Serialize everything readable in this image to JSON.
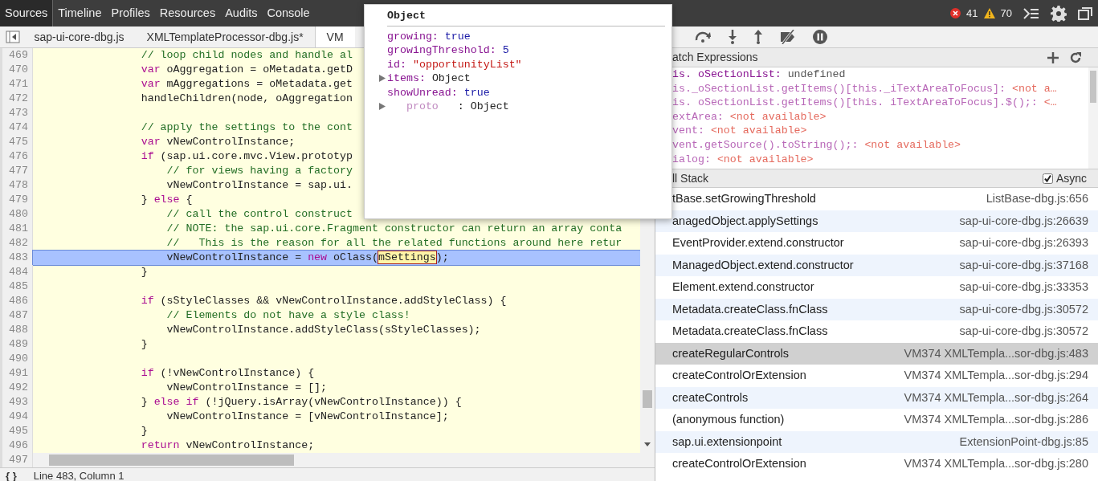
{
  "main_tabs": [
    {
      "label": "Sources",
      "selected": true
    },
    {
      "label": "Timeline",
      "selected": false
    },
    {
      "label": "Profiles",
      "selected": false
    },
    {
      "label": "Resources",
      "selected": false
    },
    {
      "label": "Audits",
      "selected": false
    },
    {
      "label": "Console",
      "selected": false
    }
  ],
  "error_count": "41",
  "warning_count": "70",
  "file_tabs": [
    {
      "label": "sap-ui-core-dbg.js",
      "selected": false
    },
    {
      "label": "XMLTemplateProcessor-dbg.js*",
      "selected": false
    },
    {
      "label": "VM",
      "selected": true
    }
  ],
  "code_lines": [
    {
      "number": "469",
      "selected": false,
      "tokens": [
        {
          "kind": "comment",
          "text": "                // loop child nodes and handle al"
        }
      ]
    },
    {
      "number": "470",
      "selected": false,
      "tokens": [
        {
          "kind": "keyword",
          "text": "                var"
        },
        {
          "kind": "plain",
          "text": " oAggregation = oMetadata.getD"
        }
      ]
    },
    {
      "number": "471",
      "selected": false,
      "tokens": [
        {
          "kind": "keyword",
          "text": "                var"
        },
        {
          "kind": "plain",
          "text": " mAggregations = oMetadata.get"
        }
      ]
    },
    {
      "number": "472",
      "selected": false,
      "tokens": [
        {
          "kind": "plain",
          "text": "                handleChildren(node, oAggregation"
        }
      ]
    },
    {
      "number": "473",
      "selected": false
    },
    {
      "number": "474",
      "selected": false,
      "tokens": [
        {
          "kind": "comment",
          "text": "                // apply the settings to the cont"
        }
      ]
    },
    {
      "number": "475",
      "selected": false,
      "tokens": [
        {
          "kind": "keyword",
          "text": "                var"
        },
        {
          "kind": "plain",
          "text": " vNewControlInstance;"
        }
      ]
    },
    {
      "number": "476",
      "selected": false,
      "tokens": [
        {
          "kind": "keyword",
          "text": "                if"
        },
        {
          "kind": "plain",
          "text": " (sap.ui.core.mvc.View.prototyp"
        }
      ]
    },
    {
      "number": "477",
      "selected": false,
      "tokens": [
        {
          "kind": "comment",
          "text": "                    // for views having a factory"
        }
      ]
    },
    {
      "number": "478",
      "selected": false,
      "tokens": [
        {
          "kind": "plain",
          "text": "                    vNewControlInstance = sap.ui."
        }
      ]
    },
    {
      "number": "479",
      "selected": false,
      "tokens": [
        {
          "kind": "plain",
          "text": "                } "
        },
        {
          "kind": "keyword",
          "text": "else"
        },
        {
          "kind": "plain",
          "text": " {"
        }
      ]
    },
    {
      "number": "480",
      "selected": false,
      "tokens": [
        {
          "kind": "comment",
          "text": "                    // call the control construct"
        }
      ]
    },
    {
      "number": "481",
      "selected": false,
      "tokens": [
        {
          "kind": "comment",
          "text": "                    // NOTE: the sap.ui.core.Fragment constructor can return an array conta"
        }
      ]
    },
    {
      "number": "482",
      "selected": false,
      "tokens": [
        {
          "kind": "comment",
          "text": "                    //   This is the reason for all the related functions around here retur"
        }
      ]
    },
    {
      "number": "483",
      "selected": true,
      "tokens": [
        {
          "kind": "plain",
          "text": "                    vNewControlInstance = "
        },
        {
          "kind": "keyword",
          "text": "new"
        },
        {
          "kind": "plain",
          "text": " oClass("
        },
        {
          "kind": "hovered",
          "text": "mSettings"
        },
        {
          "kind": "plain",
          "text": ");"
        }
      ]
    },
    {
      "number": "484",
      "selected": false,
      "tokens": [
        {
          "kind": "plain",
          "text": "                }"
        }
      ]
    },
    {
      "number": "485",
      "selected": false
    },
    {
      "number": "486",
      "selected": false,
      "tokens": [
        {
          "kind": "keyword",
          "text": "                if"
        },
        {
          "kind": "plain",
          "text": " (sStyleClasses && vNewControlInstance.addStyleClass) {"
        }
      ]
    },
    {
      "number": "487",
      "selected": false,
      "tokens": [
        {
          "kind": "comment",
          "text": "                    // Elements do not have a style class!"
        }
      ]
    },
    {
      "number": "488",
      "selected": false,
      "tokens": [
        {
          "kind": "plain",
          "text": "                    vNewControlInstance.addStyleClass(sStyleClasses);"
        }
      ]
    },
    {
      "number": "489",
      "selected": false,
      "tokens": [
        {
          "kind": "plain",
          "text": "                }"
        }
      ]
    },
    {
      "number": "490",
      "selected": false
    },
    {
      "number": "491",
      "selected": false,
      "tokens": [
        {
          "kind": "keyword",
          "text": "                if"
        },
        {
          "kind": "plain",
          "text": " (!vNewControlInstance) {"
        }
      ]
    },
    {
      "number": "492",
      "selected": false,
      "tokens": [
        {
          "kind": "plain",
          "text": "                    vNewControlInstance = [];"
        }
      ]
    },
    {
      "number": "493",
      "selected": false,
      "tokens": [
        {
          "kind": "plain",
          "text": "                } "
        },
        {
          "kind": "keyword",
          "text": "else if"
        },
        {
          "kind": "plain",
          "text": " (!jQuery.isArray(vNewControlInstance)) {"
        }
      ]
    },
    {
      "number": "494",
      "selected": false,
      "tokens": [
        {
          "kind": "plain",
          "text": "                    vNewControlInstance = [vNewControlInstance];"
        }
      ]
    },
    {
      "number": "495",
      "selected": false,
      "tokens": [
        {
          "kind": "plain",
          "text": "                }"
        }
      ]
    },
    {
      "number": "496",
      "selected": false,
      "tokens": [
        {
          "kind": "keyword",
          "text": "                return"
        },
        {
          "kind": "plain",
          "text": " vNewControlInstance;"
        }
      ]
    }
  ],
  "last_line_number": "497",
  "status_bar": {
    "icon_text": "{ }",
    "position": "Line 483, Column 1"
  },
  "popover": {
    "title": "Object",
    "properties": [
      {
        "name": "growing:",
        "value": "true",
        "kind": "literal",
        "expandable": false,
        "dimmed": false
      },
      {
        "name": "growingThreshold:",
        "value": "5",
        "kind": "literal",
        "expandable": false,
        "dimmed": false
      },
      {
        "name": "id:",
        "value": "\"opportunityList\"",
        "kind": "string",
        "expandable": false,
        "dimmed": false
      },
      {
        "name": "items:",
        "value": "Object",
        "kind": "object",
        "expandable": true,
        "dimmed": false
      },
      {
        "name": "showUnread:",
        "value": "true",
        "kind": "literal",
        "expandable": false,
        "dimmed": false
      },
      {
        "name": "proto",
        "value": ": Object",
        "kind": "object",
        "expandable": true,
        "dimmed": true
      }
    ]
  },
  "watch": {
    "title": "atch Expressions",
    "items": [
      {
        "name": "is. oSectionList:",
        "value": "undefined",
        "kind": "value"
      },
      {
        "name": "is._oSectionList.getItems()[this._iTextAreaToFocus]:",
        "value": "<not a…",
        "kind": "unavailable"
      },
      {
        "name": "is. oSectionList.getItems()[this. iTextAreaToFocus].$();:",
        "value": "<…",
        "kind": "unavailable"
      },
      {
        "name": "extArea:",
        "value": "<not available>",
        "kind": "unavailable"
      },
      {
        "name": "vent:",
        "value": "<not available>",
        "kind": "unavailable"
      },
      {
        "name": "vent.getSource().toString();:",
        "value": "<not available>",
        "kind": "unavailable"
      },
      {
        "name": "ialog:",
        "value": "<not available>",
        "kind": "unavailable"
      }
    ]
  },
  "call_stack": {
    "title": "ll Stack",
    "async_label": "Async",
    "async_checked": true,
    "frames": [
      {
        "function": "tBase.setGrowingThreshold",
        "location": "ListBase-dbg.js:656",
        "selected": false
      },
      {
        "function": "anagedObject.applySettings",
        "location": "sap-ui-core-dbg.js:26639",
        "selected": false
      },
      {
        "function": "EventProvider.extend.constructor",
        "location": "sap-ui-core-dbg.js:26393",
        "selected": false
      },
      {
        "function": "ManagedObject.extend.constructor",
        "location": "sap-ui-core-dbg.js:37168",
        "selected": false
      },
      {
        "function": "Element.extend.constructor",
        "location": "sap-ui-core-dbg.js:33353",
        "selected": false
      },
      {
        "function": "Metadata.createClass.fnClass",
        "location": "sap-ui-core-dbg.js:30572",
        "selected": false
      },
      {
        "function": "Metadata.createClass.fnClass",
        "location": "sap-ui-core-dbg.js:30572",
        "selected": false
      },
      {
        "function": "createRegularControls",
        "location": "VM374 XMLTempla...sor-dbg.js:483",
        "selected": true
      },
      {
        "function": "createControlOrExtension",
        "location": "VM374 XMLTempla...sor-dbg.js:294",
        "selected": false
      },
      {
        "function": "createControls",
        "location": "VM374 XMLTempla...sor-dbg.js:264",
        "selected": false
      },
      {
        "function": "(anonymous function)",
        "location": "VM374 XMLTempla...sor-dbg.js:286",
        "selected": false
      },
      {
        "function": "sap.ui.extensionpoint",
        "location": "ExtensionPoint-dbg.js:85",
        "selected": false
      },
      {
        "function": "createControlOrExtension",
        "location": "VM374 XMLTempla...sor-dbg.js:280",
        "selected": false
      }
    ]
  }
}
